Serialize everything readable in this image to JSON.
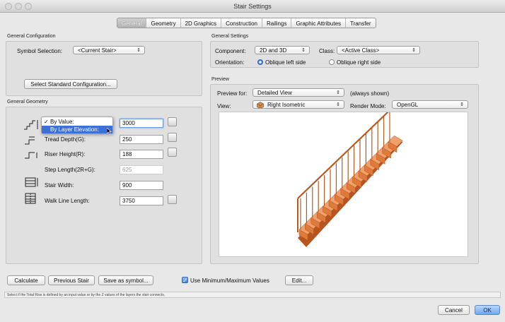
{
  "window": {
    "title": "Stair Settings"
  },
  "tabs": [
    "General",
    "Geometry",
    "2D Graphics",
    "Construction",
    "Railings",
    "Graphic Attributes",
    "Transfer"
  ],
  "active_tab": 0,
  "general_configuration": {
    "title": "General Configuration",
    "symbol_label": "Symbol Selection:",
    "symbol_value": "<Current Stair>",
    "select_standard_button": "Select Standard Configuration..."
  },
  "general_geometry": {
    "title": "General Geometry",
    "menu": {
      "by_value": "By Value:",
      "by_layer_elevation": "By Layer Elevation:",
      "checked": "✓"
    },
    "total_rise": {
      "value": "3000"
    },
    "tread_depth": {
      "label": "Tread Depth(G):",
      "value": "250"
    },
    "riser_height": {
      "label": "Riser Height(R):",
      "value": "188"
    },
    "step_length": {
      "label": "Step Length(2R+G):",
      "value": "625"
    },
    "stair_width": {
      "label": "Stair Width:",
      "value": "900"
    },
    "walk_line_length": {
      "label": "Walk Line Length:",
      "value": "3750"
    }
  },
  "general_settings": {
    "title": "General Settings",
    "component_label": "Component:",
    "component_value": "2D and 3D",
    "class_label": "Class:",
    "class_value": "<Active Class>",
    "orientation_label": "Orientation:",
    "orientation_options": [
      "Oblique left side",
      "Oblique right side"
    ],
    "orientation_selected": 0
  },
  "preview": {
    "title": "Preview",
    "preview_for_label": "Preview for:",
    "preview_for_value": "Detailed View",
    "always_shown": "(always shown)",
    "view_label": "View:",
    "view_value": "Right Isometric",
    "render_mode_label": "Render Mode:",
    "render_mode_value": "OpenGL"
  },
  "bottom": {
    "calculate": "Calculate",
    "previous_stair": "Previous Stair",
    "save_as_symbol": "Save as symbol...",
    "use_minmax_label": "Use Minimum/Maximum Values",
    "use_minmax_checked": true,
    "edit": "Edit...",
    "status_text": "Select if the Total Rise is defined by an input value or by the Z values of the layers the stair connects.",
    "cancel": "Cancel",
    "ok": "OK"
  },
  "colors": {
    "accent": "#3d6fd9",
    "stair_wood": "#e07a3c",
    "stair_wood_dark": "#b8541f"
  }
}
